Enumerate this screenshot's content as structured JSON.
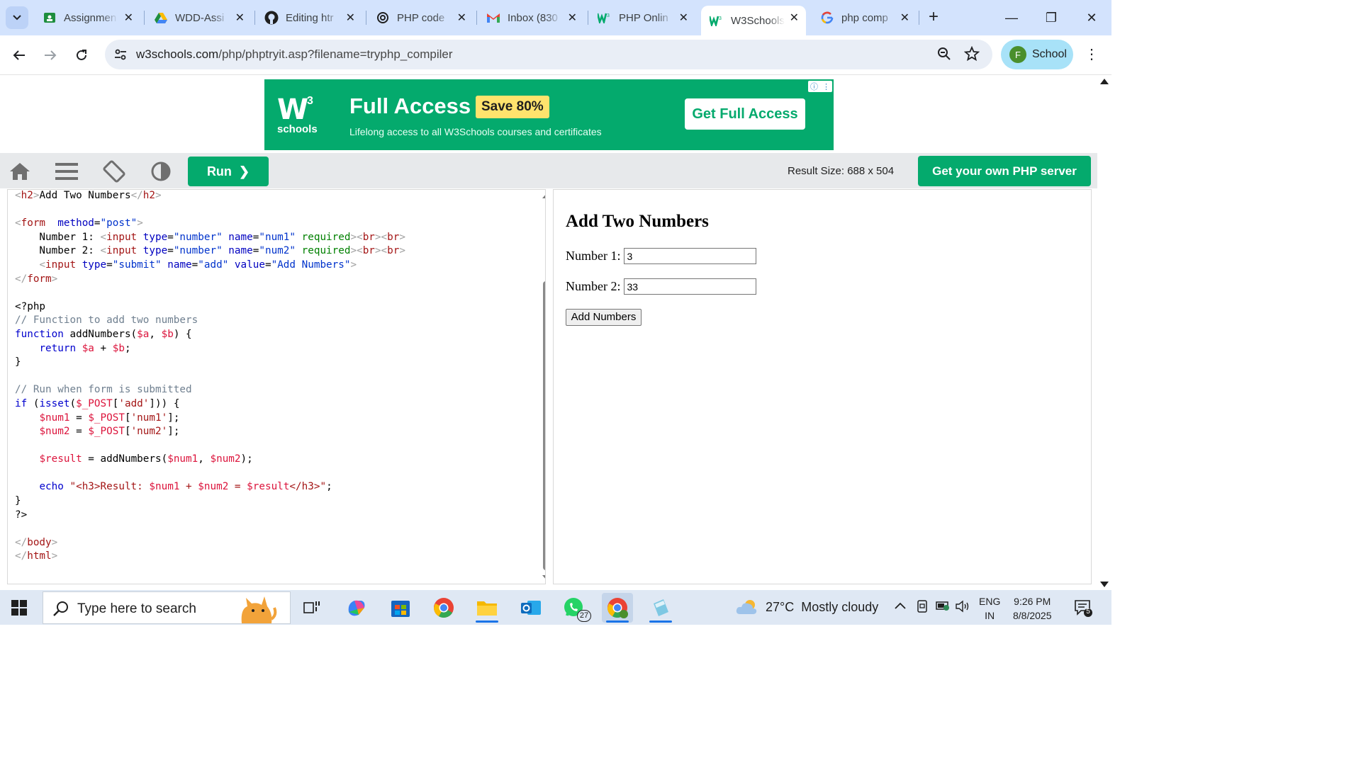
{
  "browser": {
    "tabs": [
      {
        "title": "Assignmen",
        "icon": "google-classroom-icon",
        "active": false
      },
      {
        "title": "WDD-Assi",
        "icon": "google-drive-icon",
        "active": false
      },
      {
        "title": "Editing htr",
        "icon": "github-icon",
        "active": false
      },
      {
        "title": "PHP code",
        "icon": "chatgpt-icon",
        "active": false
      },
      {
        "title": "Inbox (830",
        "icon": "gmail-icon",
        "active": false
      },
      {
        "title": "PHP Onlin",
        "icon": "w3schools-icon",
        "active": false
      },
      {
        "title": "W3Schools",
        "icon": "w3schools-icon",
        "active": true
      },
      {
        "title": "php comp",
        "icon": "google-icon",
        "active": false
      }
    ],
    "url_host": "w3schools.com",
    "url_path": "/php/phptryit.asp?filename=tryphp_compiler",
    "profile_initial": "F",
    "profile_name": "School"
  },
  "ad": {
    "logo_mark": "W",
    "logo_sup": "3",
    "logo_text": "schools",
    "headline": "Full Access",
    "badge": "Save 80%",
    "subline": "Lifelong access to all W3Schools courses and certificates",
    "cta": "Get Full Access",
    "info_glyph": "ⓘ",
    "menu_glyph": "⋮"
  },
  "tryit": {
    "run_label": "Run",
    "run_chevron": "❯",
    "result_size": "Result Size: 688 x 504",
    "server_button": "Get your own PHP server"
  },
  "result": {
    "heading": "Add Two Numbers",
    "num1_label": "Number 1:",
    "num1_value": "3",
    "num2_label": "Number 2:",
    "num2_value": "33",
    "submit_label": "Add Numbers"
  },
  "code_lines": [
    [
      [
        "br",
        "<"
      ],
      [
        "tag",
        "h2"
      ],
      [
        "br",
        ">"
      ],
      [
        "",
        "Add Two Numbers"
      ],
      [
        "br",
        "</"
      ],
      [
        "tag",
        "h2"
      ],
      [
        "br",
        ">"
      ]
    ],
    [],
    [
      [
        "br",
        "<"
      ],
      [
        "tag",
        "form"
      ],
      [
        "",
        "  "
      ],
      [
        "attr",
        "method"
      ],
      [
        "",
        "="
      ],
      [
        "val",
        "\"post\""
      ],
      [
        "br",
        ">"
      ]
    ],
    [
      [
        "",
        "    Number 1: "
      ],
      [
        "br",
        "<"
      ],
      [
        "tag",
        "input"
      ],
      [
        "",
        ""
      ],
      [
        "attr",
        " type"
      ],
      [
        "",
        "="
      ],
      [
        "val",
        "\"number\""
      ],
      [
        "attr",
        " name"
      ],
      [
        "",
        "="
      ],
      [
        "val",
        "\"num1\""
      ],
      [
        "grn",
        " required"
      ],
      [
        "br",
        "><"
      ],
      [
        "tag",
        "br"
      ],
      [
        "br",
        "><"
      ],
      [
        "tag",
        "br"
      ],
      [
        "br",
        ">"
      ]
    ],
    [
      [
        "",
        "    Number 2: "
      ],
      [
        "br",
        "<"
      ],
      [
        "tag",
        "input"
      ],
      [
        "attr",
        " type"
      ],
      [
        "",
        "="
      ],
      [
        "val",
        "\"number\""
      ],
      [
        "attr",
        " name"
      ],
      [
        "",
        "="
      ],
      [
        "val",
        "\"num2\""
      ],
      [
        "grn",
        " required"
      ],
      [
        "br",
        "><"
      ],
      [
        "tag",
        "br"
      ],
      [
        "br",
        "><"
      ],
      [
        "tag",
        "br"
      ],
      [
        "br",
        ">"
      ]
    ],
    [
      [
        "",
        "    "
      ],
      [
        "br",
        "<"
      ],
      [
        "tag",
        "input"
      ],
      [
        "attr",
        " type"
      ],
      [
        "",
        "="
      ],
      [
        "val",
        "\"submit\""
      ],
      [
        "attr",
        " name"
      ],
      [
        "",
        "="
      ],
      [
        "val",
        "\"add\""
      ],
      [
        "attr",
        " value"
      ],
      [
        "",
        "="
      ],
      [
        "val",
        "\"Add Numbers\""
      ],
      [
        "br",
        ">"
      ]
    ],
    [
      [
        "br",
        "</"
      ],
      [
        "tag",
        "form"
      ],
      [
        "br",
        ">"
      ]
    ],
    [],
    [
      [
        "",
        "<?php"
      ]
    ],
    [
      [
        "com",
        "// Function to add two numbers"
      ]
    ],
    [
      [
        "kw",
        "function"
      ],
      [
        "",
        " addNumbers("
      ],
      [
        "var",
        "$a"
      ],
      [
        "",
        ", "
      ],
      [
        "var",
        "$b"
      ],
      [
        "",
        ") {"
      ]
    ],
    [
      [
        "",
        "    "
      ],
      [
        "kw",
        "return"
      ],
      [
        "",
        ""
      ],
      [
        "var",
        " $a"
      ],
      [
        "",
        ""
      ],
      [
        "",
        " + "
      ],
      [
        "var",
        "$b"
      ],
      [
        "",
        ";"
      ]
    ],
    [
      [
        "",
        "}"
      ]
    ],
    [],
    [
      [
        "com",
        "// Run when form is submitted"
      ]
    ],
    [
      [
        "kw",
        "if"
      ],
      [
        "",
        " ("
      ],
      [
        "kw",
        "isset"
      ],
      [
        "",
        "("
      ],
      [
        "var",
        "$_POST"
      ],
      [
        "",
        "["
      ],
      [
        "str",
        "'add'"
      ],
      [
        "",
        "])) {"
      ]
    ],
    [
      [
        "",
        "    "
      ],
      [
        "var",
        "$num1"
      ],
      [
        "",
        " = "
      ],
      [
        "var",
        "$_POST"
      ],
      [
        "",
        "["
      ],
      [
        "str",
        "'num1'"
      ],
      [
        "",
        "];"
      ]
    ],
    [
      [
        "",
        "    "
      ],
      [
        "var",
        "$num2"
      ],
      [
        "",
        " = "
      ],
      [
        "var",
        "$_POST"
      ],
      [
        "",
        "["
      ],
      [
        "str",
        "'num2'"
      ],
      [
        "",
        "];"
      ]
    ],
    [],
    [
      [
        "",
        "    "
      ],
      [
        "var",
        "$result"
      ],
      [
        "",
        " = addNumbers("
      ],
      [
        "var",
        "$num1"
      ],
      [
        "",
        ", "
      ],
      [
        "var",
        "$num2"
      ],
      [
        "",
        ");"
      ]
    ],
    [],
    [
      [
        "",
        "    "
      ],
      [
        "kw",
        "echo"
      ],
      [
        "",
        ""
      ],
      [
        "str",
        " \"<h3>Result: "
      ],
      [
        "var",
        "$num1"
      ],
      [
        "str",
        " + "
      ],
      [
        "var",
        "$num2"
      ],
      [
        "str",
        " = "
      ],
      [
        "var",
        "$result"
      ],
      [
        "str",
        "</h3>\""
      ],
      [
        "",
        ";"
      ]
    ],
    [
      [
        "",
        "}"
      ]
    ],
    [
      [
        "",
        "?>"
      ]
    ],
    [],
    [
      [
        "br",
        "</"
      ],
      [
        "tag",
        "body"
      ],
      [
        "br",
        ">"
      ]
    ],
    [
      [
        "br",
        "</"
      ],
      [
        "tag",
        "html"
      ],
      [
        "br",
        ">"
      ]
    ]
  ],
  "taskbar": {
    "search_placeholder": "Type here to search",
    "whatsapp_badge": "27",
    "temperature": "27°C",
    "weather": "Mostly cloudy",
    "lang_1": "ENG",
    "lang_2": "IN",
    "time": "9:26 PM",
    "date": "8/8/2025",
    "notif_count": "5"
  },
  "colors": {
    "accent": "#04aa6d",
    "tabstrip": "#d3e3fd",
    "taskbar": "#dfe8f4"
  }
}
